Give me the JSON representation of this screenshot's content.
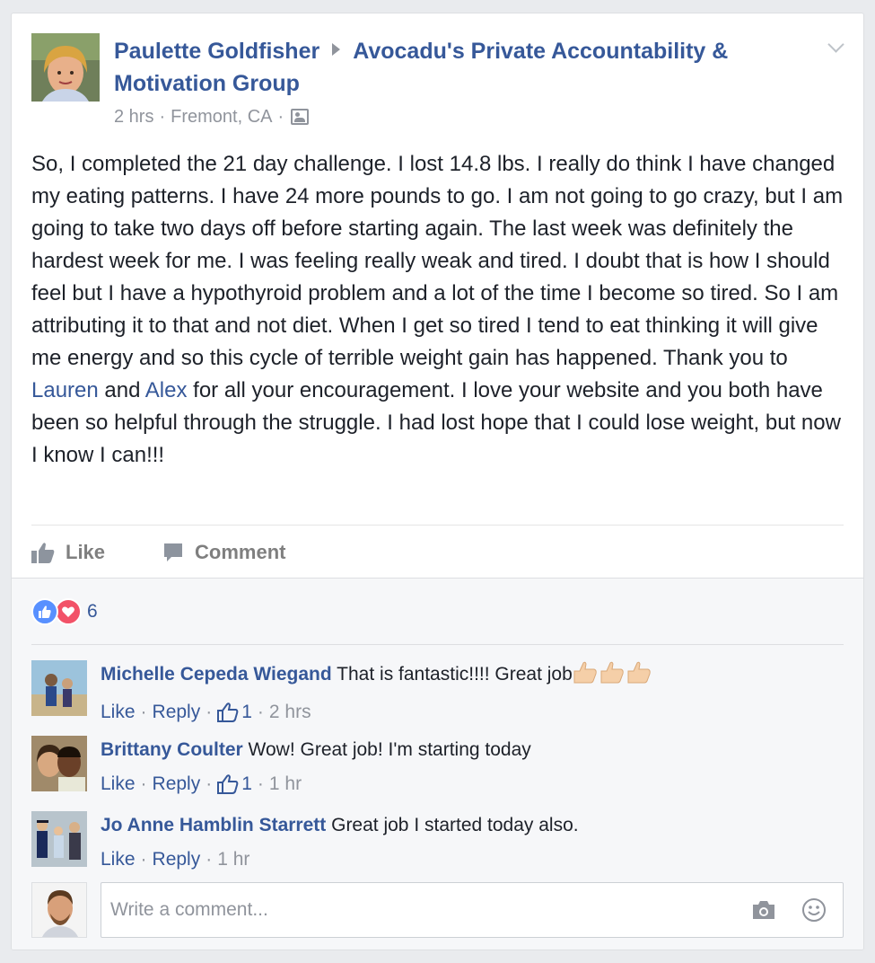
{
  "post": {
    "author": "Paulette Goldfisher",
    "group": "Avocadu's Private Accountability & Motivation Group",
    "time": "2 hrs",
    "location": "Fremont, CA",
    "body_part1": "So, I completed the 21 day challenge. I lost 14.8 lbs. I really do think I have changed my eating patterns. I have 24 more pounds to go. I am not going to go crazy, but I am going to take two days off before starting again. The last week was definitely the hardest week for me. I was feeling really weak and tired. I doubt that is how I should feel but I have a hypothyroid problem and a lot of the time I become so tired. So I am attributing it to that and not diet. When I get so tired I tend to eat thinking it will give me energy and so this cycle of terrible weight gain has happened. Thank you to ",
    "mention1": "Lauren",
    "body_part2": " and ",
    "mention2": "Alex",
    "body_part3": " for all your encouragement. I love your website and you both have been so helpful through the struggle. I had lost hope that I could lose weight, but now I know I can!!!"
  },
  "actions": {
    "like_label": "Like",
    "comment_label": "Comment"
  },
  "reactions": {
    "count": "6"
  },
  "comments": [
    {
      "name": "Michelle Cepeda Wiegand",
      "text": "That is fantastic!!!! Great job",
      "like_label": "Like",
      "reply_label": "Reply",
      "like_count": "1",
      "time": "2 hrs"
    },
    {
      "name": "Brittany Coulter",
      "text": "Wow! Great job! I'm starting today",
      "like_label": "Like",
      "reply_label": "Reply",
      "like_count": "1",
      "time": "1 hr"
    },
    {
      "name": "Jo Anne Hamblin Starrett",
      "text": "Great job I started today also.",
      "like_label": "Like",
      "reply_label": "Reply",
      "time": "1 hr"
    }
  ],
  "composer": {
    "placeholder": "Write a comment..."
  },
  "colors": {
    "link_blue": "#365899",
    "meta_gray": "#90949c",
    "like_reaction": "#5890ff",
    "love_reaction": "#f25268"
  }
}
